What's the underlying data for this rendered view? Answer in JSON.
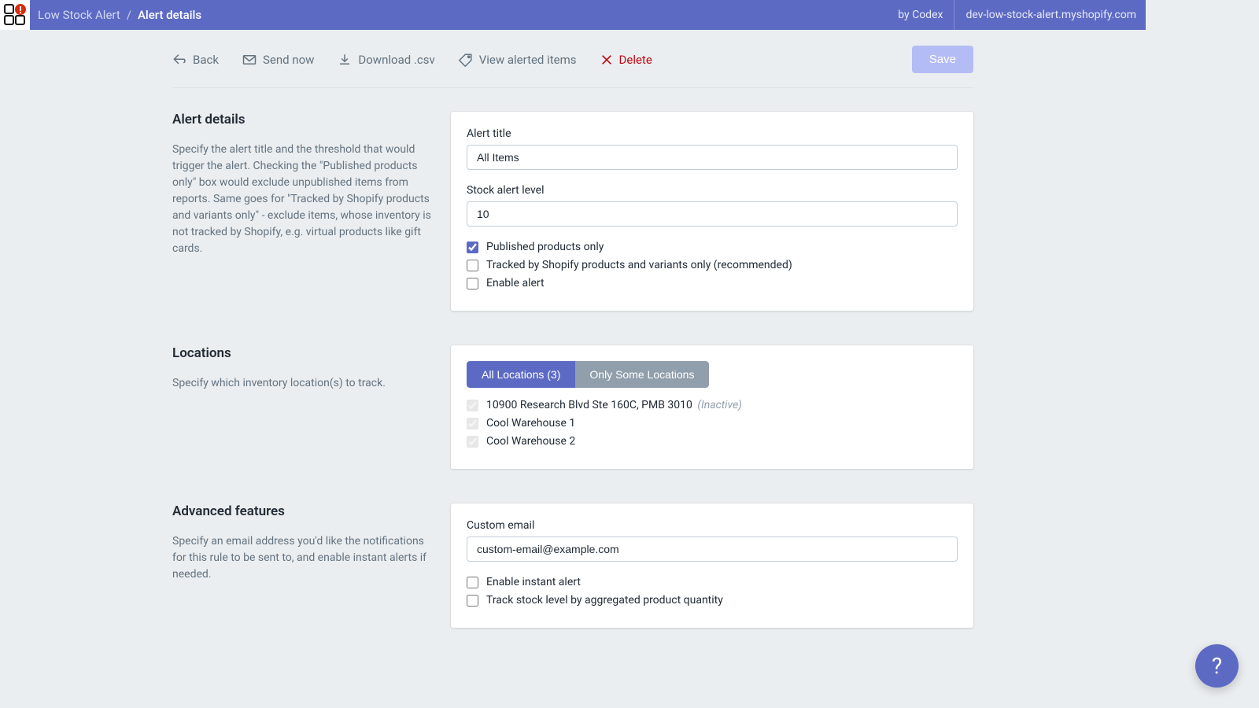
{
  "header": {
    "root": "Low Stock Alert",
    "sep": "/",
    "current": "Alert details",
    "by_codex": "by Codex",
    "shop": "dev-low-stock-alert.myshopify.com"
  },
  "toolbar": {
    "back": "Back",
    "send_now": "Send now",
    "download_csv": "Download .csv",
    "view_alerted": "View alerted items",
    "delete": "Delete",
    "save": "Save"
  },
  "sections": {
    "details": {
      "title": "Alert details",
      "desc": "Specify the alert title and the threshold that would trigger the alert. Checking the \"Published products only\" box would exclude unpublished items from reports. Same goes for \"Tracked by Shopify products and variants only\" - exclude items, whose inventory is not tracked by Shopify, e.g. virtual products like gift cards.",
      "alert_title_label": "Alert title",
      "alert_title_value": "All Items",
      "stock_level_label": "Stock alert level",
      "stock_level_value": "10",
      "cb_published": "Published products only",
      "cb_tracked": "Tracked by Shopify products and variants only (recommended)",
      "cb_enable": "Enable alert"
    },
    "locations": {
      "title": "Locations",
      "desc": "Specify which inventory location(s) to track.",
      "btn_all": "All Locations (3)",
      "btn_some": "Only Some Locations",
      "loc1": "10900 Research Blvd Ste 160C, PMB 3010",
      "loc1_inactive": "(Inactive)",
      "loc2": "Cool Warehouse 1",
      "loc3": "Cool Warehouse 2"
    },
    "advanced": {
      "title": "Advanced features",
      "desc": "Specify an email address you'd like the notifications for this rule to be sent to, and enable instant alerts if needed.",
      "custom_email_label": "Custom email",
      "custom_email_value": "custom-email@example.com",
      "cb_instant": "Enable instant alert",
      "cb_aggregate": "Track stock level by aggregated product quantity"
    }
  },
  "help": "?"
}
